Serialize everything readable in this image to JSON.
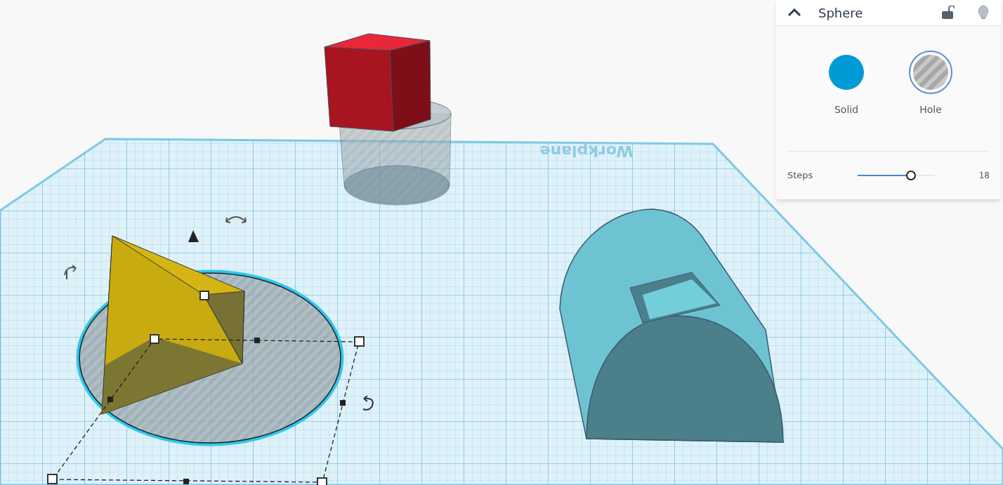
{
  "workplane": {
    "label": "Workplane"
  },
  "inspector": {
    "title": "Sphere",
    "expanded": true,
    "modes": [
      {
        "label": "Solid",
        "selected": false
      },
      {
        "label": "Hole",
        "selected": true
      }
    ],
    "steps": {
      "label": "Steps",
      "level": 0.69,
      "reading": "18"
    }
  }
}
